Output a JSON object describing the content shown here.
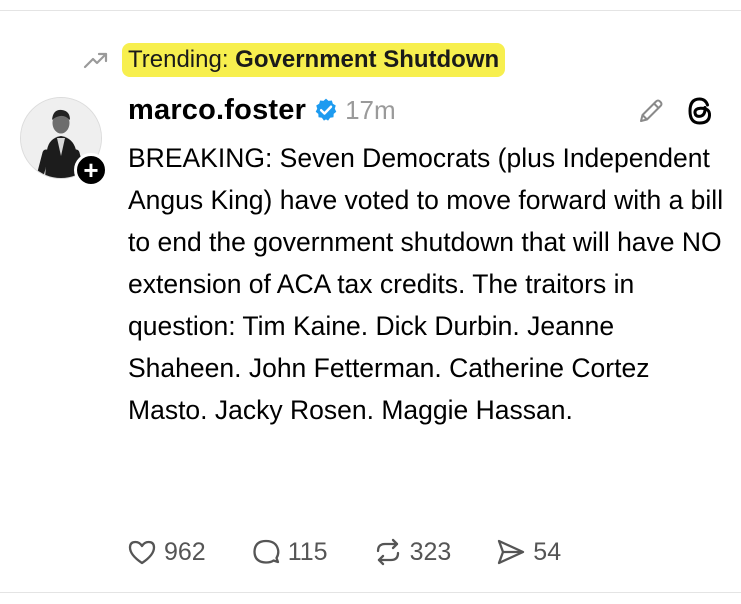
{
  "trending": {
    "label": "Trending: ",
    "topic": "Government Shutdown",
    "highlight_color": "#f7ef4e",
    "icon": "trending-up-icon"
  },
  "post": {
    "username": "marco.foster",
    "verified": true,
    "verified_color": "#1d9bf0",
    "timestamp": "17m",
    "text": "BREAKING: Seven Democrats (plus Independent Angus King) have voted to move forward with a bill to end the government shutdown that will have NO extension of ACA tax credits. The traitors in question: Tim Kaine. Dick Durbin. Jeanne Shaheen. John Fetterman. Catherine Cortez Masto. Jacky Rosen. Maggie Hassan.",
    "follow_icon": "plus-icon",
    "edit_icon": "pencil-icon",
    "app_icon": "threads-logo-icon"
  },
  "actions": {
    "likes": "962",
    "replies": "115",
    "reposts": "323",
    "shares": "54"
  }
}
